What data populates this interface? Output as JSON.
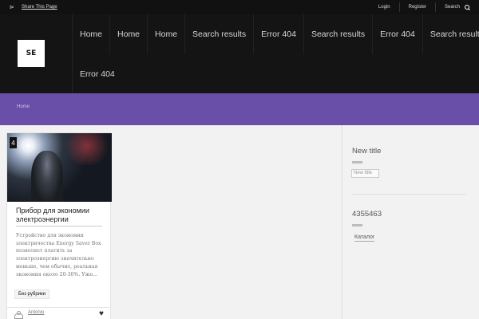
{
  "topbar": {
    "share_label": "Share This Page",
    "links": [
      {
        "label": "Login"
      },
      {
        "label": "Register"
      },
      {
        "label": "Search"
      }
    ]
  },
  "header": {
    "logo_text": "SE",
    "nav_row1": [
      "Home",
      "Home",
      "Home",
      "Search results",
      "Error 404",
      "Search results",
      "Error 404",
      "Search results"
    ],
    "nav_row2": [
      "Error 404"
    ]
  },
  "breadcrumb": {
    "label": "Home"
  },
  "post": {
    "badge": "4",
    "title": "Прибор для экономии электроэнергии",
    "excerpt": "Устройство для экономии электричества Energy Saver Box позволяет платить за электроэнергию значительно меньше, чем обычно, реальная экономия около 20-30%. Уже...",
    "category": "Без рубрики",
    "author": "Antonio"
  },
  "sidebar": {
    "widget1_title": "New title",
    "widget1_input_placeholder": "New title",
    "widget2_title": "4355463",
    "widget2_link": "Каталог"
  },
  "colors": {
    "topbar_bg": "#111111",
    "header_bg": "#141414",
    "accent_purple": "#6a4fa9",
    "page_bg": "#f2f2f2"
  },
  "icons": [
    "share-icon",
    "search-icon",
    "user-icon",
    "heart-icon"
  ]
}
